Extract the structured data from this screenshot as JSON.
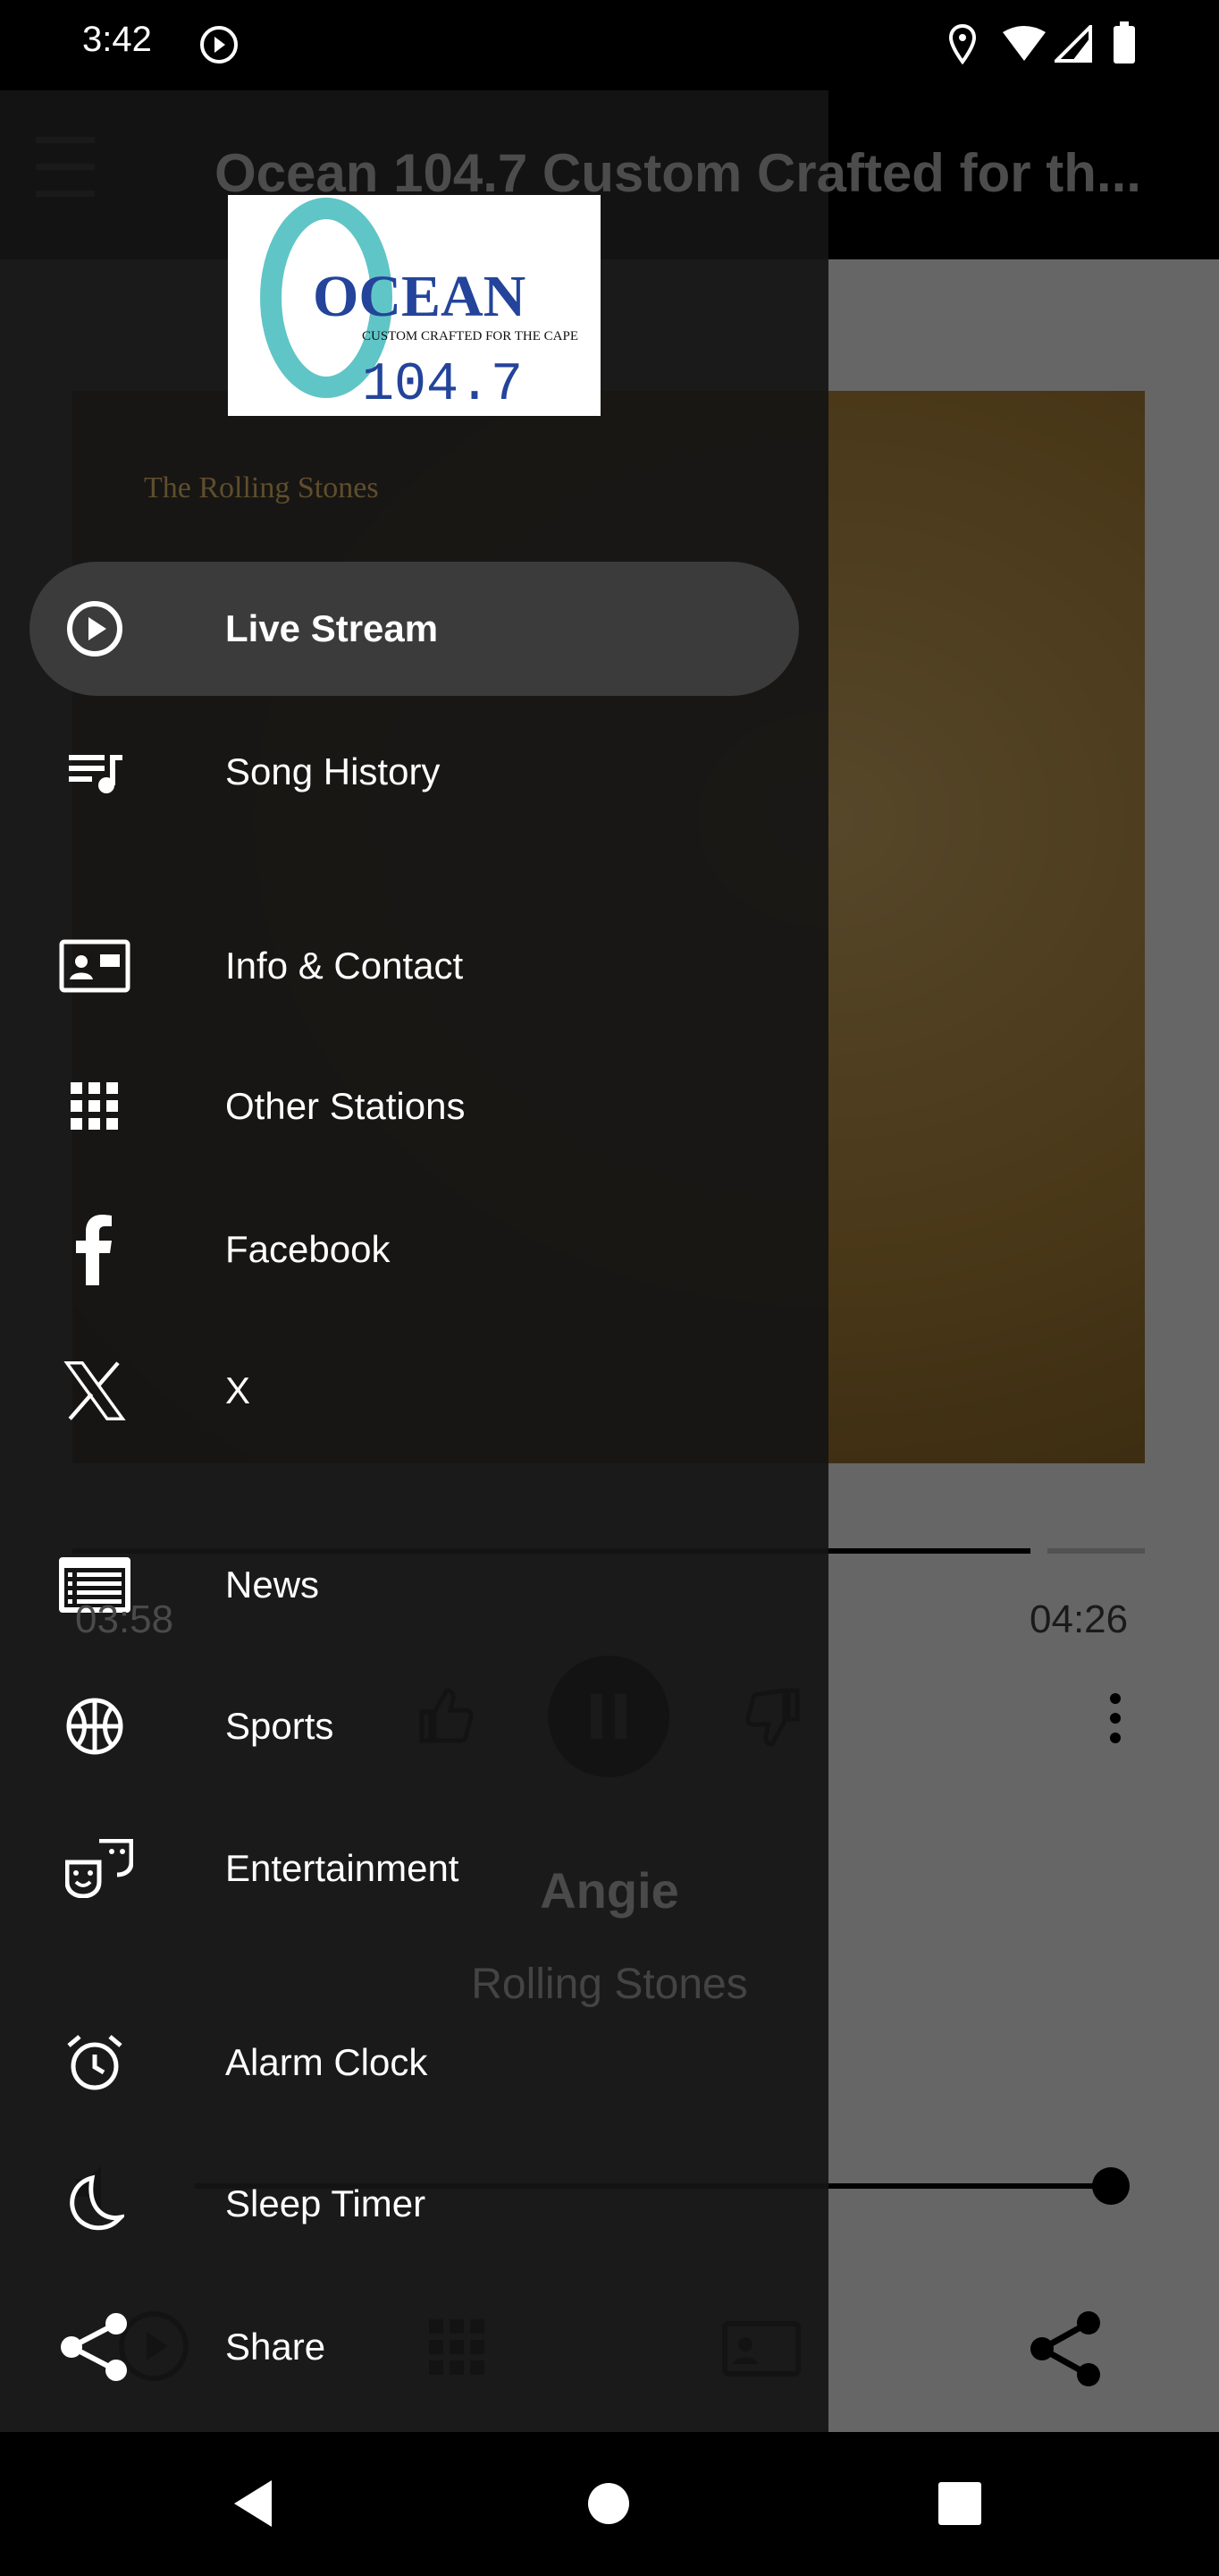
{
  "status_bar": {
    "time": "3:42",
    "icons": [
      "play-circle-icon",
      "location-icon",
      "wifi-icon",
      "signal-icon",
      "battery-icon"
    ]
  },
  "toolbar": {
    "title": "Ocean 104.7 Custom Crafted for th..."
  },
  "logo": {
    "name": "OCEAN",
    "tagline": "CUSTOM CRAFTED FOR THE CAPE",
    "frequency": "104.7",
    "colors": {
      "text": "#23449a",
      "wave": "#4fbfc0"
    }
  },
  "player": {
    "album_text": "The Rolling Stones",
    "elapsed": "03:58",
    "duration": "04:26",
    "progress_percent": 93,
    "song": "Angie",
    "artist": "Rolling Stones",
    "volume_percent": 100
  },
  "drawer": {
    "items": [
      {
        "label": "Live Stream",
        "icon": "play-circle-icon",
        "active": true
      },
      {
        "label": "Song History",
        "icon": "playlist-icon"
      },
      {
        "label": "Info & Contact",
        "icon": "contact-card-icon"
      },
      {
        "label": "Other Stations",
        "icon": "grid-icon"
      },
      {
        "label": "Facebook",
        "icon": "facebook-icon"
      },
      {
        "label": "X",
        "icon": "x-logo-icon"
      },
      {
        "label": "News",
        "icon": "news-icon"
      },
      {
        "label": "Sports",
        "icon": "basketball-icon"
      },
      {
        "label": "Entertainment",
        "icon": "theater-masks-icon"
      },
      {
        "label": "Alarm Clock",
        "icon": "alarm-clock-icon"
      },
      {
        "label": "Sleep Timer",
        "icon": "moon-icon"
      },
      {
        "label": "Share",
        "icon": "share-icon"
      }
    ]
  }
}
